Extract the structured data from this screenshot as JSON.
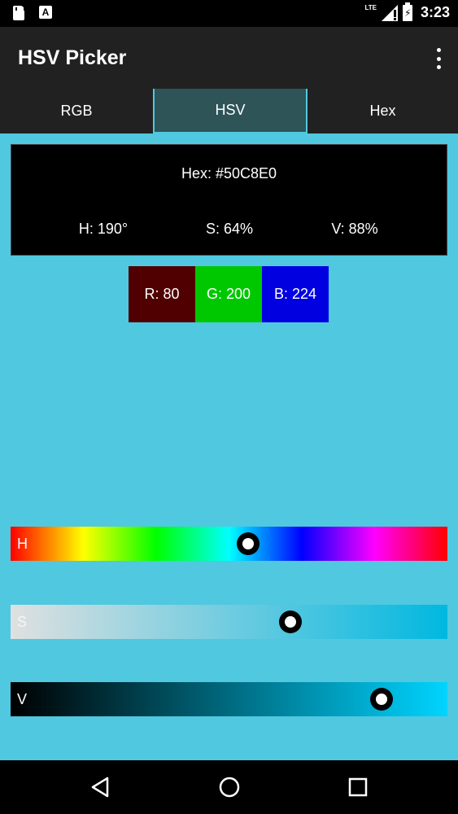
{
  "status_bar": {
    "time": "3:23",
    "network": "LTE",
    "icons": [
      "sd-card-icon",
      "keyboard-a-icon",
      "signal-icon",
      "battery-charging-icon"
    ]
  },
  "app_bar": {
    "title": "HSV Picker",
    "menu_icon": "overflow-menu-icon"
  },
  "tabs": [
    {
      "label": "RGB",
      "selected": false
    },
    {
      "label": "HSV",
      "selected": true
    },
    {
      "label": "Hex",
      "selected": false
    }
  ],
  "color_info": {
    "hex": "Hex: #50C8E0",
    "h": "H: 190°",
    "s": "S: 64%",
    "v": "V: 88%"
  },
  "rgb_boxes": {
    "r": "R: 80",
    "g": "G: 200",
    "b": "B: 224"
  },
  "sliders": {
    "h": {
      "label": "H",
      "fraction": 0.543
    },
    "s": {
      "label": "S",
      "fraction": 0.64
    },
    "v": {
      "label": "V",
      "fraction": 0.85
    }
  },
  "colors": {
    "background": "#50C8E0",
    "red_box": "#500000",
    "green_box": "#00C800",
    "blue_box": "#0000E0",
    "tab_selected": "#2E5458",
    "app_bar": "#212121"
  },
  "nav_bar": {
    "icons": [
      "back-icon",
      "home-icon",
      "recent-apps-icon"
    ]
  }
}
